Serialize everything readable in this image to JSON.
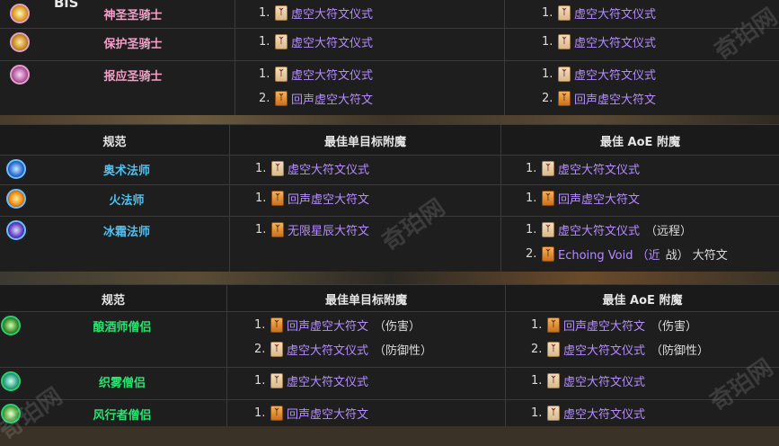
{
  "colors": {
    "paladin": "#f59fc8",
    "mage": "#4fc0ef",
    "monk": "#27e36f",
    "enchant_link": "#b48cff"
  },
  "top_left_text": "BiS",
  "watermark": "奇珀网",
  "paladin_section": {
    "rows": [
      {
        "spec": "神圣圣骑士",
        "icon": "holy-paladin-icon",
        "single": [
          {
            "n": "1.",
            "name": "虚空大符文仪式",
            "rune": "pale"
          }
        ],
        "aoe": [
          {
            "n": "1.",
            "name": "虚空大符文仪式",
            "rune": "pale"
          }
        ]
      },
      {
        "spec": "保护圣骑士",
        "icon": "protection-paladin-icon",
        "single": [
          {
            "n": "1.",
            "name": "虚空大符文仪式",
            "rune": "pale"
          }
        ],
        "aoe": [
          {
            "n": "1.",
            "name": "虚空大符文仪式",
            "rune": "pale"
          }
        ]
      },
      {
        "spec": "报应圣骑士",
        "icon": "retribution-paladin-icon",
        "single": [
          {
            "n": "1.",
            "name": "虚空大符文仪式",
            "rune": "pale"
          },
          {
            "n": "2.",
            "name": "回声虚空大符文",
            "rune": "orange"
          }
        ],
        "aoe": [
          {
            "n": "1.",
            "name": "虚空大符文仪式",
            "rune": "pale"
          },
          {
            "n": "2.",
            "name": "回声虚空大符文",
            "rune": "orange"
          }
        ]
      }
    ]
  },
  "mage_section": {
    "headers": {
      "spec": "规范",
      "single": "最佳单目标附魔",
      "aoe": "最佳 AoE 附魔"
    },
    "rows": [
      {
        "spec": "奥术法师",
        "icon": "arcane-mage-icon",
        "single": [
          {
            "n": "1.",
            "name": "虚空大符文仪式",
            "rune": "pale"
          }
        ],
        "aoe": [
          {
            "n": "1.",
            "name": "虚空大符文仪式",
            "rune": "pale"
          }
        ]
      },
      {
        "spec": "火法师",
        "icon": "fire-mage-icon",
        "single": [
          {
            "n": "1.",
            "name": "回声虚空大符文",
            "rune": "orange"
          }
        ],
        "aoe": [
          {
            "n": "1.",
            "name": "回声虚空大符文",
            "rune": "orange"
          }
        ]
      },
      {
        "spec": "冰霜法师",
        "icon": "frost-mage-icon",
        "single": [
          {
            "n": "1.",
            "name": "无限星辰大符文",
            "rune": "orange"
          }
        ],
        "aoe": [
          {
            "n": "1.",
            "name": "虚空大符文仪式",
            "rune": "pale",
            "note": "（远程）"
          },
          {
            "n": "2.",
            "name": "Echoing Void （近",
            "rune": "orange",
            "note": "战） 大符文"
          }
        ]
      }
    ]
  },
  "monk_section": {
    "headers": {
      "spec": "规范",
      "single": "最佳单目标附魔",
      "aoe": "最佳 AoE 附魔"
    },
    "rows": [
      {
        "spec": "酿酒师僧侣",
        "icon": "brewmaster-monk-icon",
        "single": [
          {
            "n": "1.",
            "name": "回声虚空大符文",
            "rune": "orange",
            "note": "（伤害）"
          },
          {
            "n": "2.",
            "name": "虚空大符文仪式",
            "rune": "pale",
            "note": "（防御性）"
          }
        ],
        "aoe": [
          {
            "n": "1.",
            "name": "回声虚空大符文",
            "rune": "orange",
            "note": "（伤害）"
          },
          {
            "n": "2.",
            "name": "虚空大符文仪式",
            "rune": "pale",
            "note": "（防御性）"
          }
        ]
      },
      {
        "spec": "织雾僧侣",
        "icon": "mistweaver-monk-icon",
        "single": [
          {
            "n": "1.",
            "name": "虚空大符文仪式",
            "rune": "pale"
          }
        ],
        "aoe": [
          {
            "n": "1.",
            "name": "虚空大符文仪式",
            "rune": "pale"
          }
        ]
      },
      {
        "spec": "风行者僧侣",
        "icon": "windwalker-monk-icon",
        "single": [
          {
            "n": "1.",
            "name": "回声虚空大符文",
            "rune": "orange"
          }
        ],
        "aoe": [
          {
            "n": "1.",
            "name": "虚空大符文仪式",
            "rune": "pale"
          }
        ]
      }
    ]
  }
}
